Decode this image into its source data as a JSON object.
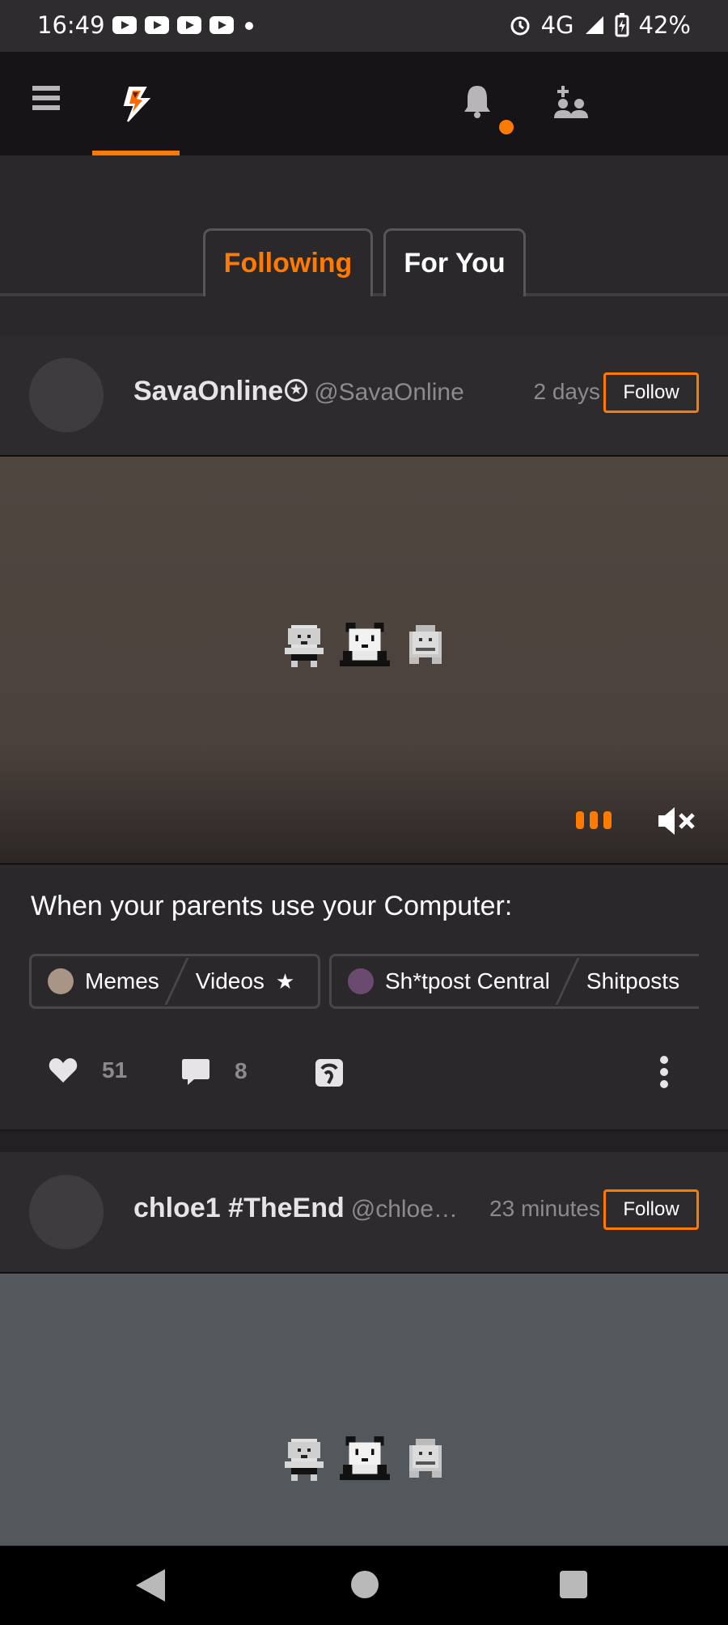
{
  "status_bar": {
    "time": "16:49",
    "network": "4G",
    "battery": "42%"
  },
  "header": {
    "menu_icon": "hamburger-menu-icon",
    "logo_icon": "lightning-logo-icon",
    "notifications_icon": "bell-icon",
    "people_icon": "users-icon",
    "accent_color": "#ff7a00"
  },
  "feed_tabs": [
    {
      "label": "Following",
      "active": true
    },
    {
      "label": "For You",
      "active": false
    }
  ],
  "posts": [
    {
      "author": "SavaOnline",
      "handle": "@SavaOnline",
      "time": "2 days",
      "follow_label": "Follow",
      "caption": "When your parents use your Computer:",
      "tags": [
        {
          "group": "Memes",
          "tag": "Videos"
        },
        {
          "group": "Sh*tpost Central",
          "tag": "Shitposts"
        }
      ],
      "likes": "51",
      "comments": "8"
    },
    {
      "author": "chloe1 #TheEnd",
      "handle": "@chloe…",
      "time": "23 minutes",
      "follow_label": "Follow"
    }
  ]
}
